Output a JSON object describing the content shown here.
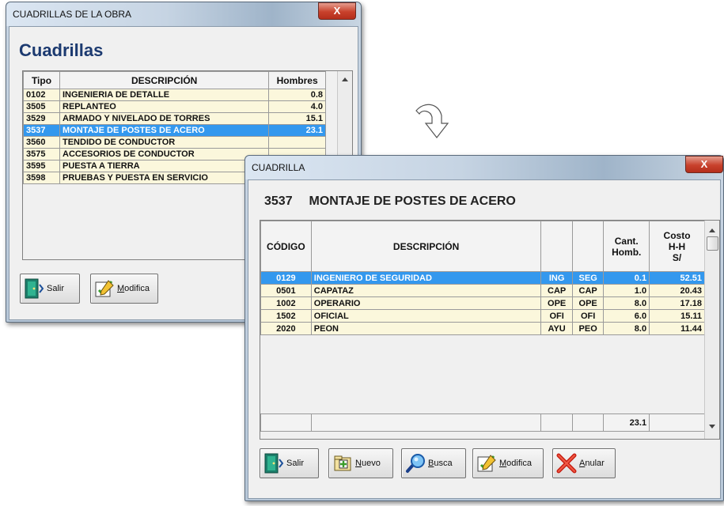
{
  "colors": {
    "selection": "#3398ee",
    "row_bg": "#fbf7dc",
    "close": "#c8412c"
  },
  "window1": {
    "title": "CUADRILLAS DE LA OBRA",
    "heading": "Cuadrillas",
    "columns": [
      "Tipo",
      "DESCRIPCIÓN",
      "Hombres"
    ],
    "rows": [
      {
        "tipo": "0102",
        "desc": "INGENIERIA DE DETALLE",
        "hombres": "0.8"
      },
      {
        "tipo": "3505",
        "desc": "REPLANTEO",
        "hombres": "4.0"
      },
      {
        "tipo": "3529",
        "desc": "ARMADO Y NIVELADO DE TORRES",
        "hombres": "15.1"
      },
      {
        "tipo": "3537",
        "desc": "MONTAJE DE POSTES DE ACERO",
        "hombres": "23.1",
        "selected": true
      },
      {
        "tipo": "3560",
        "desc": "TENDIDO DE CONDUCTOR",
        "hombres": ""
      },
      {
        "tipo": "3575",
        "desc": "ACCESORIOS DE CONDUCTOR",
        "hombres": ""
      },
      {
        "tipo": "3595",
        "desc": "PUESTA A TIERRA",
        "hombres": ""
      },
      {
        "tipo": "3598",
        "desc": "PRUEBAS Y PUESTA EN SERVICIO",
        "hombres": ""
      }
    ],
    "buttons": {
      "salir": "Salir",
      "modifica_first": "M",
      "modifica_rest": "odifica"
    },
    "close_label": "X"
  },
  "window2": {
    "title": "CUADRILLA",
    "code": "3537",
    "name": "MONTAJE DE POSTES DE ACERO",
    "columns": {
      "codigo": "CÓDIGO",
      "descripcion": "DESCRIPCIÓN",
      "cant_line1": "Cant.",
      "cant_line2": "Homb.",
      "costo_line1": "Costo",
      "costo_line2": "H-H",
      "costo_line3": "S/"
    },
    "rows": [
      {
        "codigo": "0129",
        "desc": "INGENIERO DE SEGURIDAD",
        "c1": "ING",
        "c2": "SEG",
        "cant": "0.1",
        "costo": "52.51",
        "selected": true
      },
      {
        "codigo": "0501",
        "desc": "CAPATAZ",
        "c1": "CAP",
        "c2": "CAP",
        "cant": "1.0",
        "costo": "20.43"
      },
      {
        "codigo": "1002",
        "desc": "OPERARIO",
        "c1": "OPE",
        "c2": "OPE",
        "cant": "8.0",
        "costo": "17.18"
      },
      {
        "codigo": "1502",
        "desc": "OFICIAL",
        "c1": "OFI",
        "c2": "OFI",
        "cant": "6.0",
        "costo": "15.11"
      },
      {
        "codigo": "2020",
        "desc": "PEON",
        "c1": "AYU",
        "c2": "PEO",
        "cant": "8.0",
        "costo": "11.44"
      }
    ],
    "total_cant": "23.1",
    "buttons": {
      "salir": "Salir",
      "nuevo_first": "N",
      "nuevo_rest": "uevo",
      "busca_first": "B",
      "busca_rest": "usca",
      "modifica_first": "M",
      "modifica_rest": "odifica",
      "anular_first": "A",
      "anular_rest": "nular"
    },
    "close_label": "X"
  }
}
